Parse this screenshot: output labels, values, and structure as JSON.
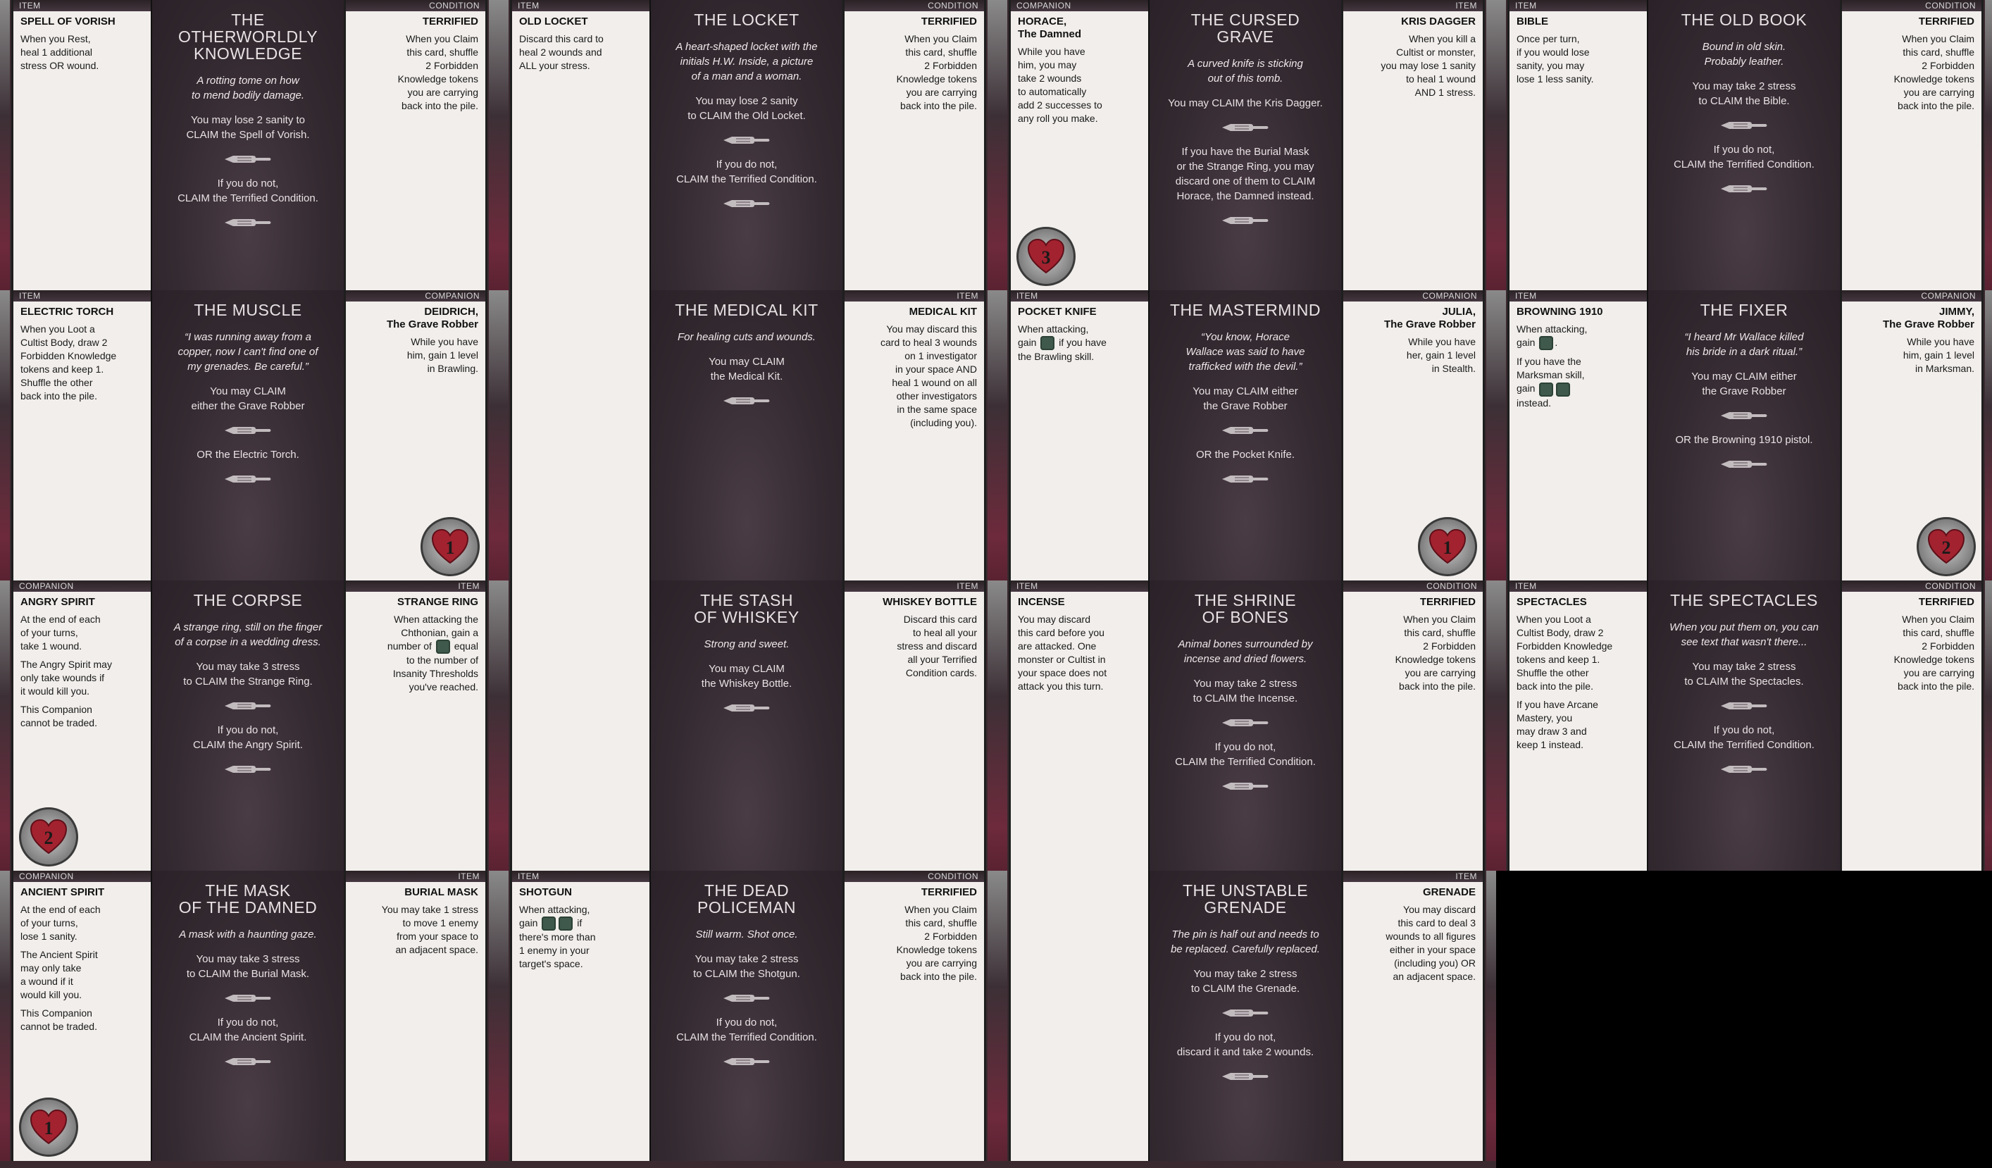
{
  "icons": {
    "claim_hand": "pointing-hand-icon",
    "dice": "success-dice-icon",
    "health": "heart-health-icon"
  },
  "colors": {
    "card_dark": "#342a31",
    "card_light": "#f1eeeb",
    "header_bar": "#2a2225",
    "band": "#6d2a3c"
  },
  "groups": [
    {
      "left": {
        "type": "ITEM",
        "title": "SPELL OF VORISH",
        "body": [
          "When you Rest,\nheal 1 additional\nstress OR wound."
        ]
      },
      "center": {
        "title": "THE OTHERWORLDLY\nKNOWLEDGE",
        "flavor": "A rotting tome on how\nto mend bodily damage.",
        "options": [
          "You may lose 2 sanity to\nCLAIM the Spell of Vorish.",
          "If you do not,\nCLAIM the Terrified Condition."
        ]
      },
      "right": {
        "type": "CONDITION",
        "title": "TERRIFIED",
        "body": [
          "When you Claim\nthis card, shuffle\n2 Forbidden\nKnowledge tokens\nyou are carrying\nback into the pile."
        ]
      }
    },
    {
      "left": {
        "type": "ITEM",
        "title": "OLD LOCKET",
        "body": [
          "Discard this card to\nheal 2 wounds and\nALL your stress."
        ]
      },
      "center": {
        "title": "THE LOCKET",
        "flavor": "A heart-shaped locket with the\ninitials H.W. Inside, a picture\nof a man and a woman.",
        "options": [
          "You may lose 2 sanity\nto CLAIM the Old Locket.",
          "If you do not,\nCLAIM the Terrified Condition."
        ]
      },
      "right": {
        "type": "CONDITION",
        "title": "TERRIFIED",
        "body": [
          "When you Claim\nthis card, shuffle\n2 Forbidden\nKnowledge tokens\nyou are carrying\nback into the pile."
        ]
      }
    },
    {
      "left": {
        "type": "COMPANION",
        "title": "HORACE,\nThe Damned",
        "body": [
          "While you have\nhim, you may\ntake 2 wounds\nto automatically\nadd 2 successes to\nany roll you make."
        ],
        "health": "3"
      },
      "center": {
        "title": "THE CURSED\nGRAVE",
        "flavor": "A curved knife is sticking\nout of this tomb.",
        "options": [
          "You may CLAIM the Kris Dagger.",
          "If you have the Burial Mask\nor the Strange Ring, you may\ndiscard one of them to CLAIM\nHorace, the Damned instead."
        ]
      },
      "right": {
        "type": "ITEM",
        "title": "KRIS DAGGER",
        "body": [
          "When you kill a\nCultist or monster,\nyou may lose 1 sanity\nto heal 1 wound\nAND 1 stress."
        ]
      }
    },
    {
      "left": {
        "type": "ITEM",
        "title": "BIBLE",
        "body": [
          "Once per turn,\nif you would lose\nsanity, you may\nlose 1 less sanity."
        ]
      },
      "center": {
        "title": "THE OLD BOOK",
        "flavor": "Bound in old skin.\nProbably leather.",
        "options": [
          "You may take 2 stress\nto CLAIM the Bible.",
          "If you do not,\nCLAIM the Terrified Condition."
        ]
      },
      "right": {
        "type": "CONDITION",
        "title": "TERRIFIED",
        "body": [
          "When you Claim\nthis card, shuffle\n2 Forbidden\nKnowledge tokens\nyou are carrying\nback into the pile."
        ]
      }
    },
    {
      "left": {
        "type": "ITEM",
        "title": "ELECTRIC TORCH",
        "body": [
          "When you Loot a\nCultist Body, draw 2\nForbidden Knowledge\ntokens and keep 1.\nShuffle the other\nback into the pile."
        ]
      },
      "center": {
        "title": "THE MUSCLE",
        "flavor": "“I was running away from a\ncopper, now I can't find one of\nmy grenades. Be careful.”",
        "options": [
          "You may CLAIM\neither the Grave Robber",
          "OR the Electric Torch."
        ]
      },
      "right": {
        "type": "COMPANION",
        "title": "DEIDRICH,\nThe Grave Robber",
        "body": [
          "While you have\nhim, gain 1 level\nin Brawling."
        ],
        "health": "1"
      }
    },
    {
      "left": {
        "type": "",
        "title": "",
        "body": []
      },
      "center": {
        "title": "THE MEDICAL KIT",
        "flavor": "For healing cuts and wounds.",
        "options": [
          "You may CLAIM\nthe Medical Kit."
        ]
      },
      "right": {
        "type": "ITEM",
        "title": "MEDICAL KIT",
        "body": [
          "You may discard this\ncard to heal 3 wounds\non 1 investigator\nin your space AND\nheal 1 wound on all\nother investigators\nin the same space\n(including you)."
        ]
      }
    },
    {
      "left": {
        "type": "ITEM",
        "title": "POCKET KNIFE",
        "body": [
          "When attacking,\ngain [dice] if you have\nthe Brawling skill."
        ]
      },
      "center": {
        "title": "THE MASTERMIND",
        "flavor": "“You know, Horace\nWallace was said to have\ntrafficked with the devil.”",
        "options": [
          "You may CLAIM either\nthe Grave Robber",
          "OR the Pocket Knife."
        ]
      },
      "right": {
        "type": "COMPANION",
        "title": "JULIA,\nThe Grave Robber",
        "body": [
          "While you have\nher, gain 1 level\nin Stealth."
        ],
        "health": "1"
      }
    },
    {
      "left": {
        "type": "ITEM",
        "title": "BROWNING 1910",
        "body": [
          "When attacking,\ngain [dice].",
          "If you have the\nMarksman skill,\ngain [dice][dice]\ninstead."
        ]
      },
      "center": {
        "title": "THE FIXER",
        "flavor": "“I heard Mr Wallace killed\nhis bride in a dark ritual.”",
        "options": [
          "You may CLAIM either\nthe Grave Robber",
          "OR the Browning 1910 pistol."
        ]
      },
      "right": {
        "type": "COMPANION",
        "title": "JIMMY,\nThe Grave Robber",
        "body": [
          "While you have\nhim, gain 1 level\nin Marksman."
        ],
        "health": "2"
      }
    },
    {
      "left": {
        "type": "COMPANION",
        "title": "ANGRY SPIRIT",
        "body": [
          "At the end of each\nof your turns,\ntake 1 wound.",
          "The Angry Spirit may\nonly take wounds if\nit would kill you.",
          "This Companion\ncannot be traded."
        ],
        "health": "2"
      },
      "center": {
        "title": "THE CORPSE",
        "flavor": "A strange ring, still on the finger\nof a corpse in a wedding dress.",
        "options": [
          "You may take 3 stress\nto CLAIM the Strange Ring.",
          "If you do not,\nCLAIM the Angry Spirit."
        ]
      },
      "right": {
        "type": "ITEM",
        "title": "STRANGE RING",
        "body": [
          "When attacking the\nChthonian, gain a\nnumber of [dice] equal\nto the number of\nInsanity Thresholds\nyou've reached."
        ]
      }
    },
    {
      "left": {
        "type": "",
        "title": "",
        "body": []
      },
      "center": {
        "title": "THE STASH\nOF WHISKEY",
        "flavor": "Strong and sweet.",
        "options": [
          "You may CLAIM\nthe Whiskey Bottle."
        ]
      },
      "right": {
        "type": "ITEM",
        "title": "WHISKEY BOTTLE",
        "body": [
          "Discard this card\nto heal all your\nstress and discard\nall your Terrified\nCondition cards."
        ]
      }
    },
    {
      "left": {
        "type": "ITEM",
        "title": "INCENSE",
        "body": [
          "You may discard\nthis card before you\nare attacked. One\nmonster or Cultist in\nyour space does not\nattack you this turn."
        ]
      },
      "center": {
        "title": "THE SHRINE\nOF BONES",
        "flavor": "Animal bones surrounded by\nincense and dried flowers.",
        "options": [
          "You may take 2 stress\nto CLAIM the Incense.",
          "If you do not,\nCLAIM the Terrified Condition."
        ]
      },
      "right": {
        "type": "CONDITION",
        "title": "TERRIFIED",
        "body": [
          "When you Claim\nthis card, shuffle\n2 Forbidden\nKnowledge tokens\nyou are carrying\nback into the pile."
        ]
      }
    },
    {
      "left": {
        "type": "ITEM",
        "title": "SPECTACLES",
        "body": [
          "When you Loot a\nCultist Body, draw 2\nForbidden Knowledge\ntokens and keep 1.\nShuffle the other\nback into the pile.",
          "If you have Arcane\nMastery, you\nmay draw 3 and\nkeep 1 instead."
        ]
      },
      "center": {
        "title": "THE SPECTACLES",
        "flavor": "When you put them on, you can\nsee text that wasn't there...",
        "options": [
          "You may take 2 stress\nto CLAIM the Spectacles.",
          "If you do not,\nCLAIM the Terrified Condition."
        ]
      },
      "right": {
        "type": "CONDITION",
        "title": "TERRIFIED",
        "body": [
          "When you Claim\nthis card, shuffle\n2 Forbidden\nKnowledge tokens\nyou are carrying\nback into the pile."
        ]
      }
    },
    {
      "left": {
        "type": "COMPANION",
        "title": "ANCIENT SPIRIT",
        "body": [
          "At the end of each\nof your turns,\nlose 1 sanity.",
          "The Ancient Spirit\nmay only take\na wound if it\nwould kill you.",
          "This Companion\ncannot be traded."
        ],
        "health": "1"
      },
      "center": {
        "title": "THE MASK\nOF THE DAMNED",
        "flavor": "A mask with a haunting gaze.",
        "options": [
          "You may take 3 stress\nto CLAIM the Burial Mask.",
          "If you do not,\nCLAIM the Ancient Spirit."
        ]
      },
      "right": {
        "type": "ITEM",
        "title": "BURIAL MASK",
        "body": [
          "You may take 1 stress\nto move 1 enemy\nfrom your space to\nan adjacent space."
        ]
      }
    },
    {
      "left": {
        "type": "ITEM",
        "title": "SHOTGUN",
        "body": [
          "When attacking,\ngain [dice][dice] if\nthere's more than\n1 enemy in your\ntarget's space."
        ]
      },
      "center": {
        "title": "THE DEAD\nPOLICEMAN",
        "flavor": "Still warm. Shot once.",
        "options": [
          "You may take 2 stress\nto CLAIM the Shotgun.",
          "If you do not,\nCLAIM the Terrified Condition."
        ]
      },
      "right": {
        "type": "CONDITION",
        "title": "TERRIFIED",
        "body": [
          "When you Claim\nthis card, shuffle\n2 Forbidden\nKnowledge tokens\nyou are carrying\nback into the pile."
        ]
      }
    },
    {
      "left": {
        "type": "",
        "title": "",
        "body": []
      },
      "center": {
        "title": "THE UNSTABLE\nGRENADE",
        "flavor": "The pin is half out and needs to\nbe replaced. Carefully replaced.",
        "options": [
          "You may take 2 stress\nto CLAIM the Grenade.",
          "If you do not,\ndiscard it and take 2 wounds."
        ]
      },
      "right": {
        "type": "ITEM",
        "title": "GRENADE",
        "body": [
          "You may discard\nthis card to deal 3\nwounds to all figures\neither in your space\n(including you) OR\nan adjacent space."
        ]
      }
    }
  ]
}
